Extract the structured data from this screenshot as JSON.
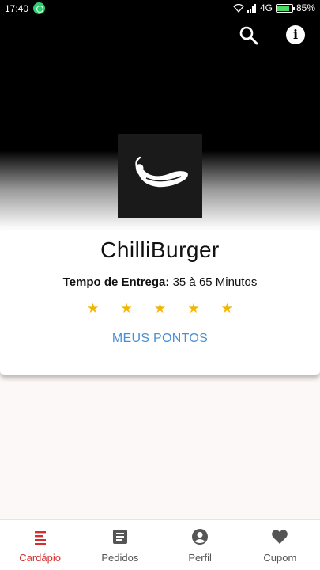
{
  "status_bar": {
    "time": "17:40",
    "network": "4G",
    "battery_percent": "85%",
    "battery_level": 0.85
  },
  "toolbar": {
    "search_icon": "search-icon",
    "info_icon": "info-icon"
  },
  "restaurant": {
    "name": "ChilliBurger",
    "delivery_label": "Tempo de Entrega:",
    "delivery_value": "35 à 65 Minutos",
    "rating": 5,
    "rating_max": 5,
    "points_button": "MEUS PONTOS"
  },
  "bottom_nav": {
    "items": [
      {
        "label": "Cardápio",
        "icon": "menu-list-icon",
        "active": true
      },
      {
        "label": "Pedidos",
        "icon": "receipt-icon",
        "active": false
      },
      {
        "label": "Perfil",
        "icon": "account-icon",
        "active": false
      },
      {
        "label": "Cupom",
        "icon": "heart-icon",
        "active": false
      }
    ]
  },
  "colors": {
    "accent_active": "#d32f2f",
    "link_blue": "#4a8fd6",
    "star_gold": "#f2b600",
    "icon_inactive": "#555555"
  }
}
